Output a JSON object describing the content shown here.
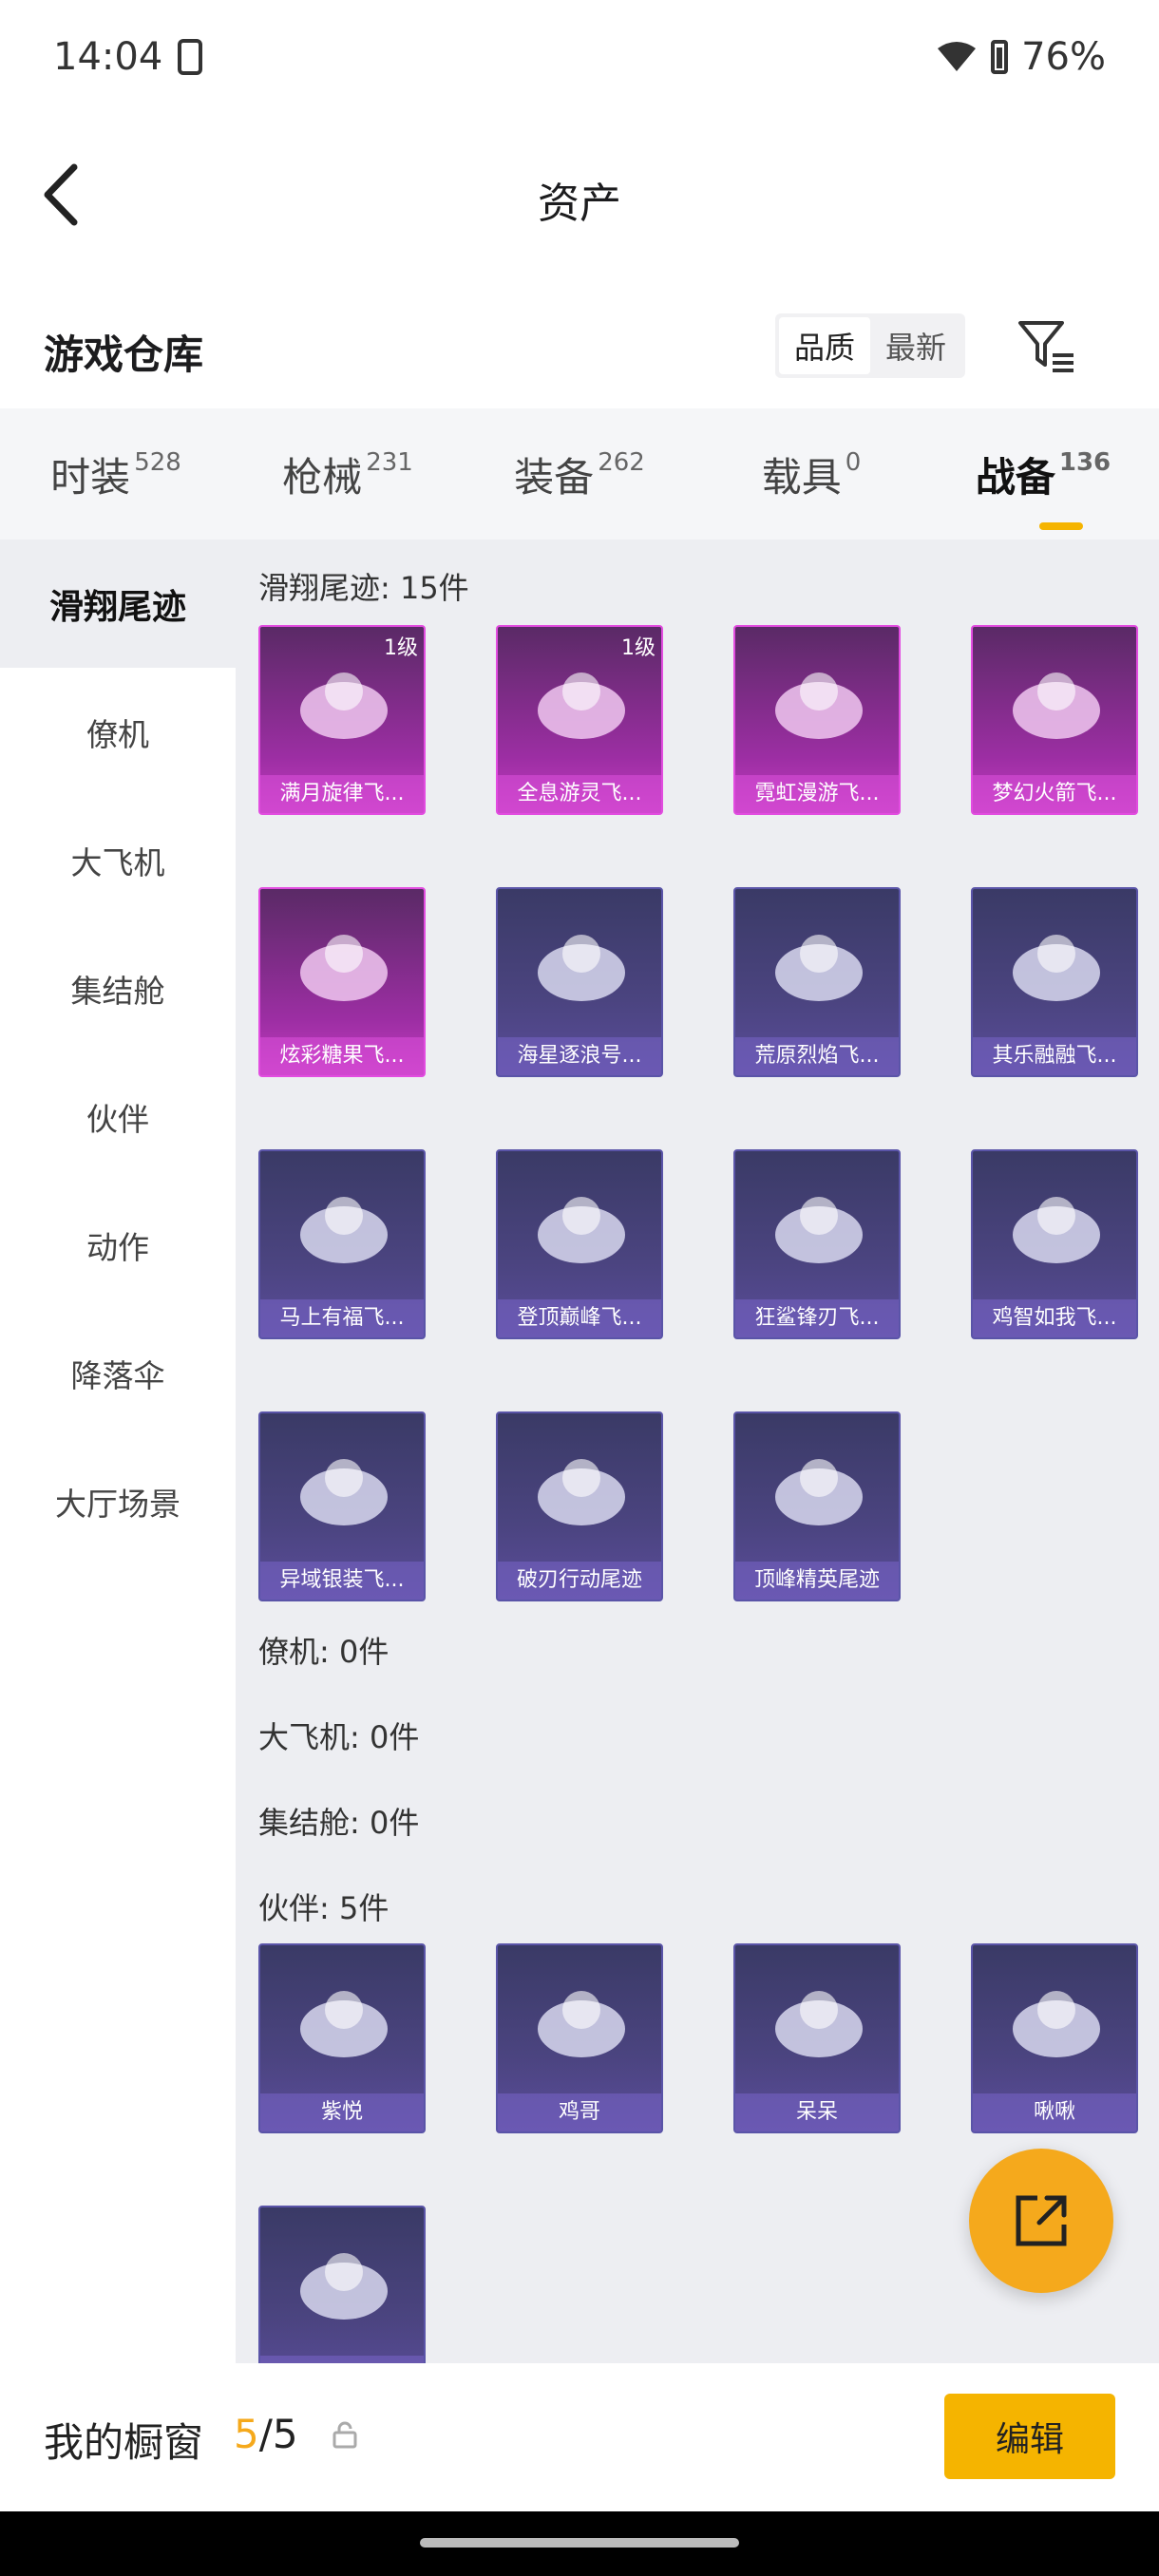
{
  "status": {
    "time": "14:04",
    "battery": "76%"
  },
  "header": {
    "title": "资产"
  },
  "section": {
    "title": "游戏仓库",
    "sort_quality": "品质",
    "sort_latest": "最新"
  },
  "tabs": [
    {
      "label": "时装",
      "count": "528"
    },
    {
      "label": "枪械",
      "count": "231"
    },
    {
      "label": "装备",
      "count": "262"
    },
    {
      "label": "载具",
      "count": "0"
    },
    {
      "label": "战备",
      "count": "136"
    }
  ],
  "sidebar": [
    "滑翔尾迹",
    "僚机",
    "大飞机",
    "集结舱",
    "伙伴",
    "动作",
    "降落伞",
    "大厅场景"
  ],
  "groups": {
    "glide": {
      "label": "滑翔尾迹: 15件"
    },
    "wingman": {
      "label": "僚机: 0件"
    },
    "plane": {
      "label": "大飞机: 0件"
    },
    "capsule": {
      "label": "集结舱: 0件"
    },
    "partner": {
      "label": "伙伴: 5件"
    }
  },
  "glide_items": [
    {
      "name": "满月旋律飞...",
      "level": "1级",
      "rarity": "pink",
      "icon": "carriage-icon"
    },
    {
      "name": "全息游灵飞...",
      "level": "1级",
      "rarity": "pink",
      "icon": "gamepad-icon"
    },
    {
      "name": "霓虹漫游飞...",
      "level": "",
      "rarity": "pink",
      "icon": "rocket-icon"
    },
    {
      "name": "梦幻火箭飞...",
      "level": "",
      "rarity": "pink",
      "icon": "glider-icon"
    },
    {
      "name": "炫彩糖果飞...",
      "level": "",
      "rarity": "pink",
      "icon": "candy-icon"
    },
    {
      "name": "海星逐浪号...",
      "level": "",
      "rarity": "blue",
      "icon": "boat-icon"
    },
    {
      "name": "荒原烈焰飞...",
      "level": "",
      "rarity": "blue",
      "icon": "flame-glider-icon"
    },
    {
      "name": "其乐融融飞...",
      "level": "",
      "rarity": "blue",
      "icon": "penguin-icon"
    },
    {
      "name": "马上有福飞...",
      "level": "",
      "rarity": "blue",
      "icon": "horse-icon"
    },
    {
      "name": "登顶巅峰飞...",
      "level": "",
      "rarity": "blue",
      "icon": "jet-icon"
    },
    {
      "name": "狂鲨锋刃飞...",
      "level": "",
      "rarity": "blue",
      "icon": "shark-icon"
    },
    {
      "name": "鸡智如我飞...",
      "level": "",
      "rarity": "blue",
      "icon": "chicken-icon"
    },
    {
      "name": "异域银装飞...",
      "level": "",
      "rarity": "blue",
      "icon": "wing-icon"
    },
    {
      "name": "破刃行动尾迹",
      "level": "",
      "rarity": "blue",
      "icon": "rainbow-trail-icon"
    },
    {
      "name": "顶峰精英尾迹",
      "level": "",
      "rarity": "blue",
      "icon": "flame-trail-icon"
    }
  ],
  "partner_items": [
    {
      "name": "紫悦",
      "rarity": "blue",
      "icon": "pony-icon"
    },
    {
      "name": "鸡哥",
      "rarity": "blue",
      "icon": "chicken-icon"
    },
    {
      "name": "呆呆",
      "rarity": "blue",
      "icon": "chick-icon"
    },
    {
      "name": "啾啾",
      "rarity": "blue",
      "icon": "bird-icon"
    },
    {
      "name": "",
      "rarity": "blue",
      "icon": "soldier-chick-icon"
    }
  ],
  "showcase": {
    "label": "我的橱窗",
    "current": "5",
    "total": "/5",
    "edit": "编辑"
  },
  "colors": {
    "accent": "#f5b400",
    "pink_card": "#c33cc0",
    "blue_card": "#4b4480"
  }
}
